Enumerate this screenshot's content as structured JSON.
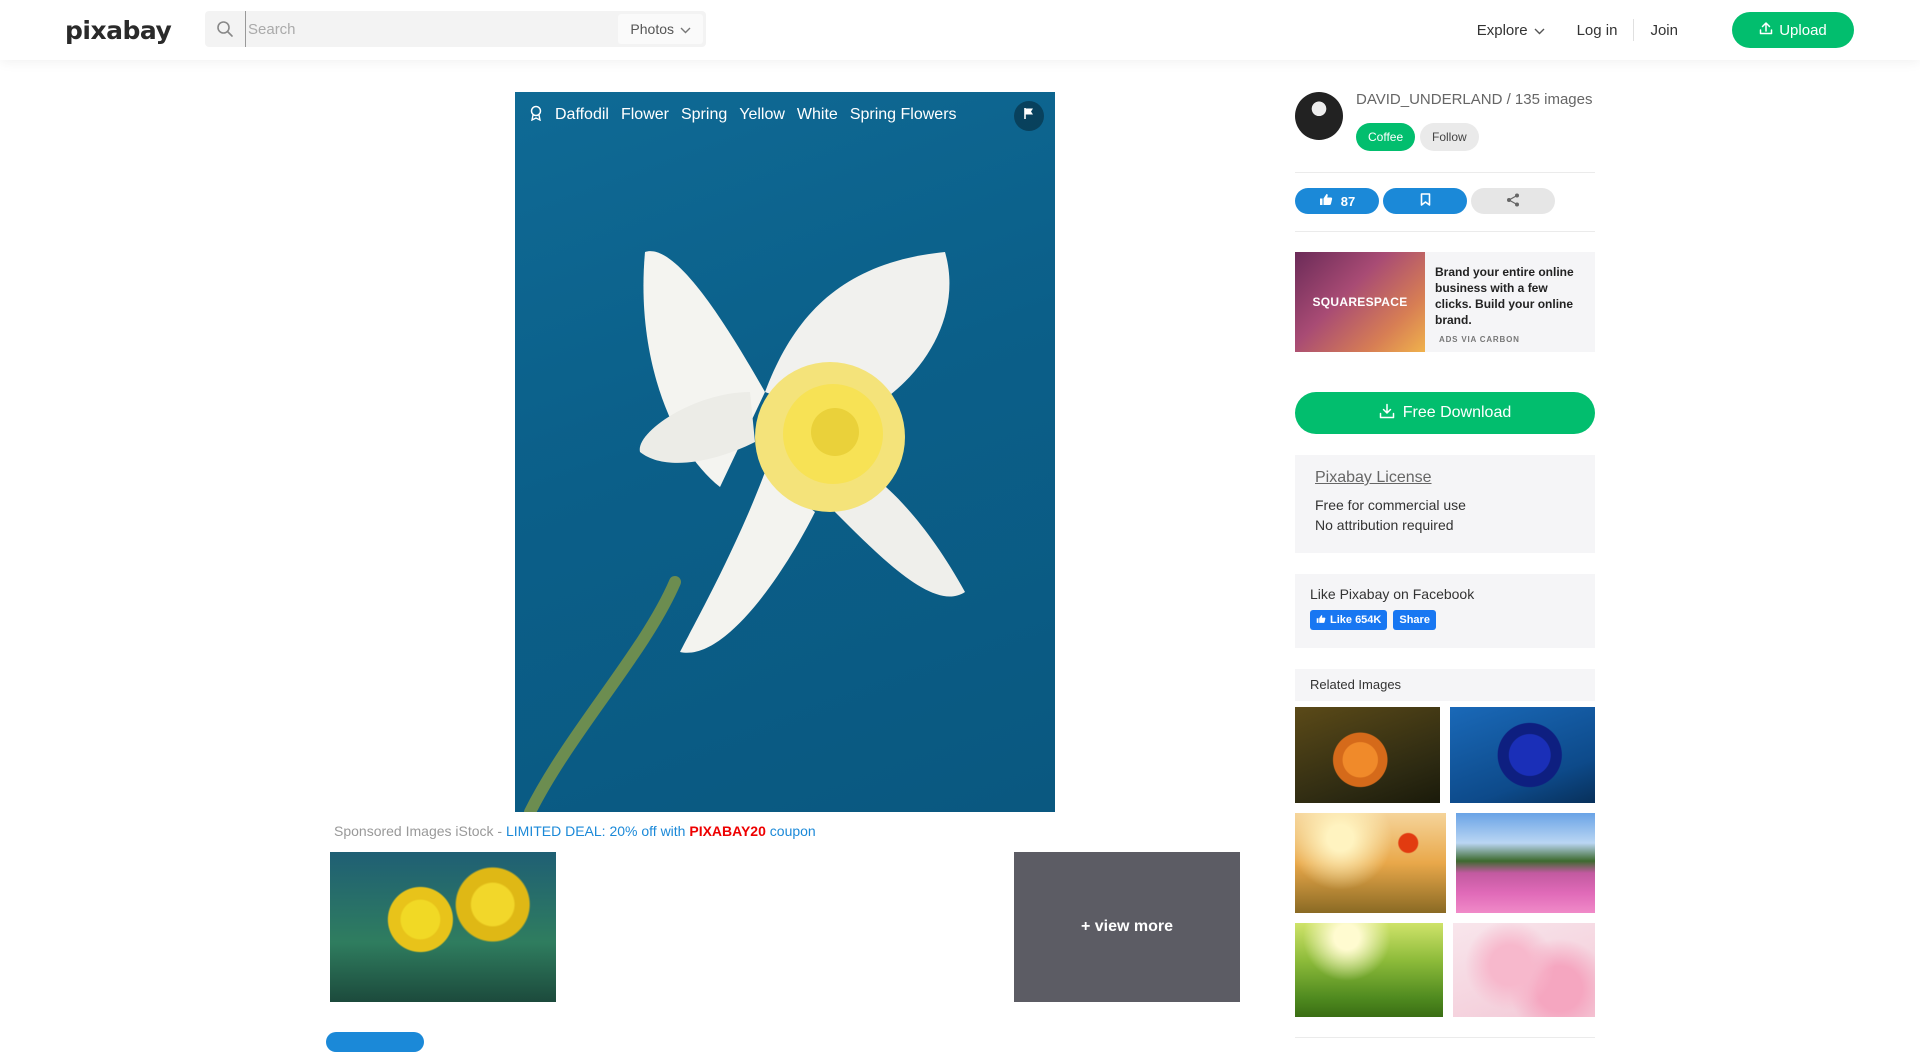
{
  "header": {
    "logo_text": "pixabay",
    "search_placeholder": "Search",
    "search_type": "Photos",
    "explore_label": "Explore",
    "login_label": "Log in",
    "join_label": "Join",
    "upload_label": "Upload"
  },
  "image": {
    "tags": [
      "Daffodil",
      "Flower",
      "Spring",
      "Yellow",
      "White",
      "Spring Flowers"
    ]
  },
  "sponsored": {
    "prefix": "Sponsored Images iStock - ",
    "deal": "LIMITED DEAL: 20% off with ",
    "code": "PIXABAY20",
    "suffix": " coupon",
    "view_more_label": "+ view more"
  },
  "author": {
    "line": "DAVID_UNDERLAND / 135 images",
    "coffee_label": "Coffee",
    "follow_label": "Follow"
  },
  "actions": {
    "likes": "87"
  },
  "ad": {
    "brand": "SQUARESPACE",
    "copy": "Brand your entire online business with a few clicks. Build your online brand.",
    "via": "ADS VIA CARBON"
  },
  "download": {
    "label": "Free Download"
  },
  "license": {
    "title": "Pixabay License",
    "line1": "Free for commercial use",
    "line2": "No attribution required"
  },
  "facebook": {
    "title": "Like Pixabay on Facebook",
    "like_label": "Like 654K",
    "share_label": "Share"
  },
  "related": {
    "title": "Related Images"
  },
  "colors": {
    "accent_green": "#02be6e",
    "accent_blue": "#1b89d8",
    "coupon_red": "#e00000"
  }
}
